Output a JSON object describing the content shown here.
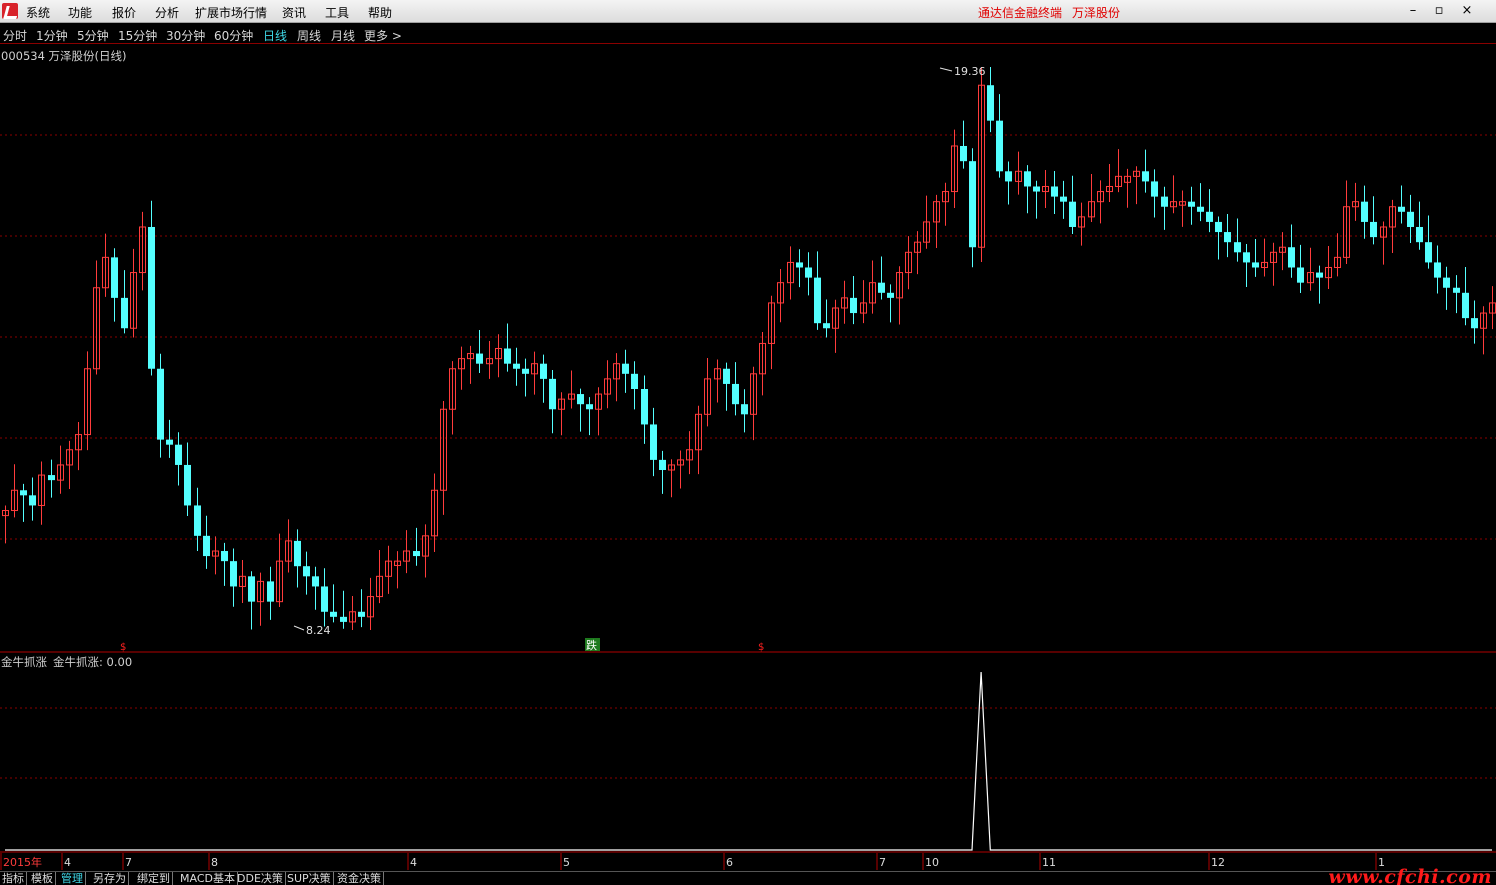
{
  "menu": {
    "items": [
      "系统",
      "功能",
      "报价",
      "分析",
      "扩展市场行情",
      "资讯",
      "工具",
      "帮助"
    ],
    "brand_app": "通达信金融终端",
    "brand_stock": "万泽股份"
  },
  "periods": {
    "items": [
      "分时",
      "1分钟",
      "5分钟",
      "15分钟",
      "30分钟",
      "60分钟",
      "日线",
      "周线",
      "月线",
      "更多 >"
    ],
    "active": "日线"
  },
  "main_chart": {
    "title": "000534 万泽股份(日线)",
    "high_label": "19.36",
    "low_label": "8.24",
    "markers": [
      "$",
      "跌",
      "$"
    ]
  },
  "indicator": {
    "name": "金牛抓涨",
    "value_label": "金牛抓涨: 0.00"
  },
  "time_axis": {
    "labels": [
      "2015年",
      "4",
      "7",
      "8",
      "4",
      "5",
      "6",
      "7",
      "10",
      "11",
      "12",
      "1"
    ]
  },
  "bottom_tabs": {
    "items": [
      "指标",
      "模板",
      "管理",
      "另存为",
      "绑定到",
      "MACD基本",
      "DDE决策",
      "SUP决策",
      "资金决策"
    ],
    "active": "管理"
  },
  "watermark": "www.cfchi.com",
  "colors": {
    "up": "#ff3c3c",
    "down": "#54ffff",
    "grid": "#8a0000",
    "active_tab": "#3fd7e6",
    "brand": "#e00000"
  },
  "chart_data": {
    "type": "candlestick",
    "title": "000534 万泽股份(日线)",
    "price_high": 19.36,
    "price_low": 8.24,
    "indicator_spike_value": 1.0,
    "indicator_current_value": 0.0,
    "closes": [
      10.6,
      11.0,
      10.9,
      10.7,
      11.3,
      11.2,
      11.5,
      11.8,
      12.1,
      13.4,
      15.0,
      15.6,
      14.8,
      14.2,
      15.3,
      16.2,
      13.4,
      12.0,
      11.9,
      11.5,
      10.7,
      10.1,
      9.7,
      9.8,
      9.6,
      9.1,
      9.3,
      8.8,
      9.2,
      8.8,
      9.6,
      10.0,
      9.5,
      9.3,
      9.1,
      8.6,
      8.5,
      8.4,
      8.6,
      8.5,
      8.9,
      9.3,
      9.6,
      9.6,
      9.8,
      9.7,
      10.1,
      11.0,
      12.6,
      13.4,
      13.6,
      13.7,
      13.5,
      13.6,
      13.8,
      13.5,
      13.4,
      13.3,
      13.5,
      13.2,
      12.6,
      12.8,
      12.9,
      12.7,
      12.6,
      12.9,
      13.2,
      13.5,
      13.3,
      13.0,
      12.3,
      11.6,
      11.4,
      11.5,
      11.6,
      11.8,
      12.5,
      13.2,
      13.4,
      13.1,
      12.7,
      12.5,
      13.3,
      13.9,
      14.7,
      15.1,
      15.5,
      15.4,
      15.2,
      14.3,
      14.2,
      14.6,
      14.8,
      14.5,
      14.7,
      15.1,
      14.9,
      14.8,
      15.3,
      15.7,
      15.9,
      16.3,
      16.7,
      16.9,
      17.8,
      17.5,
      15.8,
      19.0,
      18.3,
      17.3,
      17.1,
      17.3,
      17.0,
      16.9,
      17.0,
      16.8,
      16.7,
      16.2,
      16.4,
      16.7,
      16.9,
      17.0,
      17.2,
      17.2,
      17.3,
      17.1,
      16.8,
      16.6,
      16.7,
      16.7,
      16.6,
      16.5,
      16.3,
      16.1,
      15.9,
      15.7,
      15.5,
      15.4,
      15.5,
      15.7,
      15.8,
      15.4,
      15.1,
      15.3,
      15.2,
      15.4,
      15.6,
      16.6,
      16.7,
      16.3,
      16.0,
      16.2,
      16.6,
      16.5,
      16.2,
      15.9,
      15.5,
      15.2,
      15.0,
      14.9,
      14.4,
      14.2,
      14.5,
      14.7
    ]
  }
}
